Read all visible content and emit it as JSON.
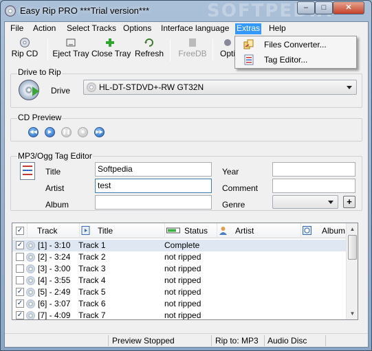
{
  "window": {
    "title": "Easy Rip PRO ***Trial version***",
    "watermark": "SOFTPEDIA",
    "min_glyph": "–",
    "max_glyph": "□",
    "close_glyph": "✕"
  },
  "menu": [
    "File",
    "Action",
    "Select Tracks",
    "Options",
    "Interface language",
    "Extras",
    "Help"
  ],
  "extras_menu": [
    {
      "label": "Files Converter...",
      "icon": "files-converter-icon"
    },
    {
      "label": "Tag Editor...",
      "icon": "tag-editor-icon"
    }
  ],
  "toolbar": {
    "rip_cd": "Rip CD",
    "eject_tray": "Eject Tray",
    "close_tray": "Close Tray",
    "refresh": "Refresh",
    "freedb": "FreeDB",
    "options": "Opti"
  },
  "drive": {
    "group": "Drive to Rip",
    "label": "Drive",
    "value": "HL-DT-STDVD+-RW GT32N"
  },
  "preview": {
    "group": "CD Preview"
  },
  "tags": {
    "group": "MP3/Ogg Tag Editor",
    "title_label": "Title",
    "title_value": "Softpedia",
    "artist_label": "Artist",
    "artist_value": "test",
    "album_label": "Album",
    "album_value": "",
    "year_label": "Year",
    "year_value": "",
    "comment_label": "Comment",
    "comment_value": "",
    "genre_label": "Genre",
    "genre_value": "",
    "add_glyph": "+"
  },
  "tracks": {
    "columns": {
      "check": "✓",
      "track": "Track",
      "title": "Title",
      "status": "Status",
      "artist": "Artist",
      "album": "Album"
    },
    "rows": [
      {
        "track": "[1] - 3:10",
        "title": "Track 1",
        "status": "Complete",
        "checked": "✓"
      },
      {
        "track": "[2] - 3:24",
        "title": "Track 2",
        "status": "not ripped",
        "checked": ""
      },
      {
        "track": "[3] - 3:00",
        "title": "Track 3",
        "status": "not ripped",
        "checked": ""
      },
      {
        "track": "[4] - 3:55",
        "title": "Track 4",
        "status": "not ripped",
        "checked": ""
      },
      {
        "track": "[5] - 2:49",
        "title": "Track 5",
        "status": "not ripped",
        "checked": "✓"
      },
      {
        "track": "[6] - 3:07",
        "title": "Track 6",
        "status": "not ripped",
        "checked": "✓"
      },
      {
        "track": "[7] - 4:09",
        "title": "Track 7",
        "status": "not ripped",
        "checked": "✓"
      }
    ]
  },
  "status": {
    "preview": "Preview Stopped",
    "rip_to": "Rip to: MP3",
    "disc": "Audio Disc"
  }
}
